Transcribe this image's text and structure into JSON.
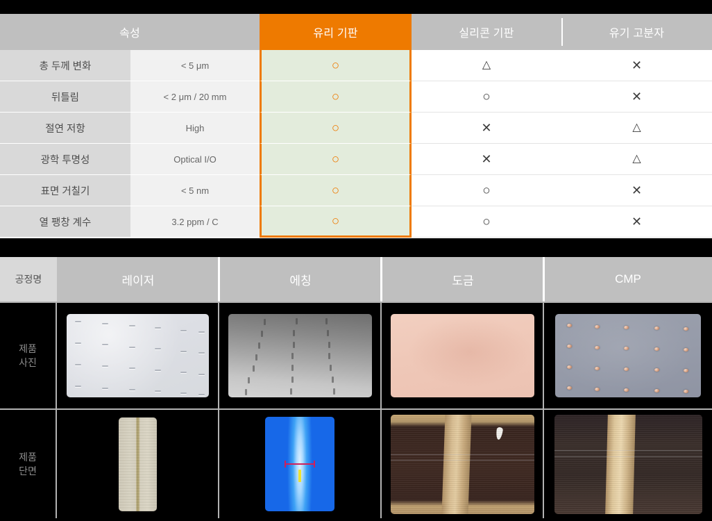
{
  "comparison_table": {
    "headers": {
      "attribute": "속성",
      "columns": [
        {
          "label": "유리 기판",
          "highlight": true
        },
        {
          "label": "실리콘 기판",
          "highlight": false
        },
        {
          "label": "유기 고분자",
          "highlight": false
        }
      ]
    },
    "accent_color": "#ee7a00",
    "highlight_cell_bg": "#e3ecdc",
    "header_bg": "#bfbfbf",
    "rows": [
      {
        "name": "총 두께 변화",
        "spec": "< 5 μm",
        "glass": "○",
        "silicon": "△",
        "polymer": "✕"
      },
      {
        "name": "뒤틀림",
        "spec": "< 2 μm / 20 mm",
        "glass": "○",
        "silicon": "○",
        "polymer": "✕"
      },
      {
        "name": "절연 저항",
        "spec": "High",
        "glass": "○",
        "silicon": "✕",
        "polymer": "△"
      },
      {
        "name": "광학 투명성",
        "spec": "Optical I/O",
        "glass": "○",
        "silicon": "✕",
        "polymer": "△"
      },
      {
        "name": "표면 거칠기",
        "spec": "< 5 nm",
        "glass": "○",
        "silicon": "○",
        "polymer": "✕"
      },
      {
        "name": "열 팽창 계수",
        "spec": "3.2 ppm / C",
        "glass": "○",
        "silicon": "○",
        "polymer": "✕"
      }
    ]
  },
  "process_table": {
    "corner_label": "공정명",
    "process_columns": [
      "레이저",
      "에칭",
      "도금",
      "CMP"
    ],
    "row_labels": [
      {
        "line1": "제품",
        "line2": "사진"
      },
      {
        "line1": "제품",
        "line2": "단면"
      }
    ],
    "photos": {
      "row1": [
        "laser-panel-photo",
        "etching-panel-photo",
        "plating-panel-photo",
        "cmp-panel-photo"
      ],
      "row2": [
        "laser-cross-section",
        "etching-cross-section",
        "plating-cross-section",
        "cmp-cross-section"
      ]
    }
  }
}
